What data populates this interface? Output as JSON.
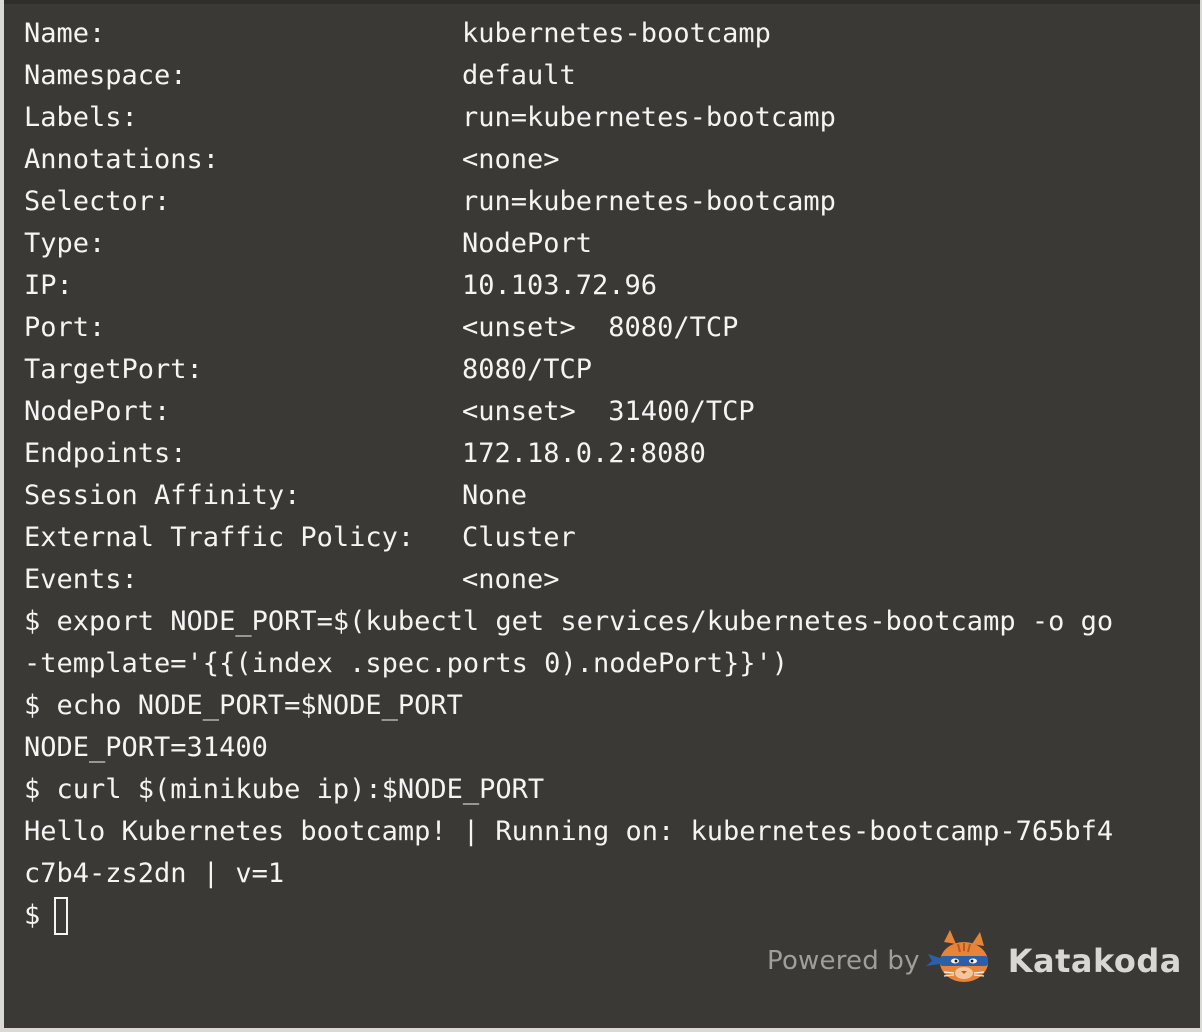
{
  "describe": [
    {
      "key": "Name:",
      "value": "kubernetes-bootcamp"
    },
    {
      "key": "Namespace:",
      "value": "default"
    },
    {
      "key": "Labels:",
      "value": "run=kubernetes-bootcamp"
    },
    {
      "key": "Annotations:",
      "value": "<none>"
    },
    {
      "key": "Selector:",
      "value": "run=kubernetes-bootcamp"
    },
    {
      "key": "Type:",
      "value": "NodePort"
    },
    {
      "key": "IP:",
      "value": "10.103.72.96"
    },
    {
      "key": "Port:",
      "value": "<unset>  8080/TCP"
    },
    {
      "key": "TargetPort:",
      "value": "8080/TCP"
    },
    {
      "key": "NodePort:",
      "value": "<unset>  31400/TCP"
    },
    {
      "key": "Endpoints:",
      "value": "172.18.0.2:8080"
    },
    {
      "key": "Session Affinity:",
      "value": "None"
    },
    {
      "key": "External Traffic Policy:",
      "value": "Cluster"
    },
    {
      "key": "Events:",
      "value": "<none>"
    }
  ],
  "session": [
    "$ export NODE_PORT=$(kubectl get services/kubernetes-bootcamp -o go",
    "-template='{{(index .spec.ports 0).nodePort}}')",
    "$ echo NODE_PORT=$NODE_PORT",
    "NODE_PORT=31400",
    "$ curl $(minikube ip):$NODE_PORT",
    "Hello Kubernetes bootcamp! | Running on: kubernetes-bootcamp-765bf4",
    "c7b4-zs2dn | v=1"
  ],
  "prompt": "$",
  "footer": {
    "powered_by": "Powered by",
    "brand": "Katakoda",
    "logo_icon": "kitten-ninja-icon"
  },
  "colors": {
    "background": "#3a3935",
    "text": "#f4f4f2",
    "footer_text": "#9f9e9b",
    "logo_orange": "#e8843a",
    "logo_blue": "#2b5fa8"
  }
}
